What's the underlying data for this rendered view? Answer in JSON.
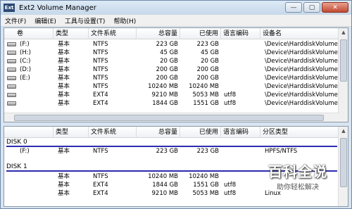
{
  "window": {
    "icon_text": "Ext",
    "title": "Ext2 Volume Manager",
    "minimize": "—",
    "maximize": "▢",
    "close": "✕"
  },
  "menu": [
    "文件(F)",
    "编辑(E)",
    "工具与设置(T)",
    "帮助(H)"
  ],
  "top_table": {
    "headers": [
      "卷",
      "类型",
      "文件系统",
      "总容量",
      "已使用",
      "语言编码",
      "设备名"
    ],
    "rows": [
      {
        "vol": "(F:)",
        "type": "基本",
        "fs": "NTFS",
        "total": "223 GB",
        "used": "223 GB",
        "codepage": "",
        "device": "\\Device\\HarddiskVolume1"
      },
      {
        "vol": "(H:)",
        "type": "基本",
        "fs": "NTFS",
        "total": "45 GB",
        "used": "45 GB",
        "codepage": "",
        "device": "\\Device\\HarddiskVolume2"
      },
      {
        "vol": "(C:)",
        "type": "基本",
        "fs": "NTFS",
        "total": "20 GB",
        "used": "20 GB",
        "codepage": "",
        "device": "\\Device\\HarddiskVolume3"
      },
      {
        "vol": "(D:)",
        "type": "基本",
        "fs": "NTFS",
        "total": "200 GB",
        "used": "200 GB",
        "codepage": "",
        "device": "\\Device\\HarddiskVolume4"
      },
      {
        "vol": "(E:)",
        "type": "基本",
        "fs": "NTFS",
        "total": "200 GB",
        "used": "200 GB",
        "codepage": "",
        "device": "\\Device\\HarddiskVolume5"
      },
      {
        "vol": "",
        "type": "基本",
        "fs": "NTFS",
        "total": "10240 MB",
        "used": "10240 MB",
        "codepage": "",
        "device": "\\Device\\HarddiskVolume6"
      },
      {
        "vol": "",
        "type": "基本",
        "fs": "EXT4",
        "total": "9210 MB",
        "used": "5053 MB",
        "codepage": "utf8",
        "device": "\\Device\\HarddiskVolume7"
      },
      {
        "vol": "",
        "type": "基本",
        "fs": "EXT4",
        "total": "1844 GB",
        "used": "1551 GB",
        "codepage": "utf8",
        "device": "\\Device\\HarddiskVolume8"
      }
    ]
  },
  "bottom_table": {
    "headers": [
      "",
      "类型",
      "文件系统",
      "总容量",
      "已使用",
      "语言编码",
      "分区类型"
    ],
    "disks": [
      {
        "label": "DISK 0",
        "rows": [
          {
            "vol": "(F:)",
            "type": "基本",
            "fs": "NTFS",
            "total": "223 GB",
            "used": "223 GB",
            "codepage": "",
            "ptype": "HPFS/NTFS"
          }
        ]
      },
      {
        "label": "DISK 1",
        "rows": [
          {
            "vol": "",
            "type": "基本",
            "fs": "NTFS",
            "total": "10240 MB",
            "used": "10240 MB",
            "codepage": "",
            "ptype": ""
          },
          {
            "vol": "",
            "type": "基本",
            "fs": "EXT4",
            "total": "1844 GB",
            "used": "1551 GB",
            "codepage": "utf8",
            "ptype": ""
          },
          {
            "vol": "",
            "type": "基本",
            "fs": "EXT4",
            "total": "9210 MB",
            "used": "5053 MB",
            "codepage": "utf8",
            "ptype": "Linux"
          }
        ]
      }
    ]
  },
  "watermark": {
    "main": "百科全说",
    "sub": "助你轻松解决"
  }
}
